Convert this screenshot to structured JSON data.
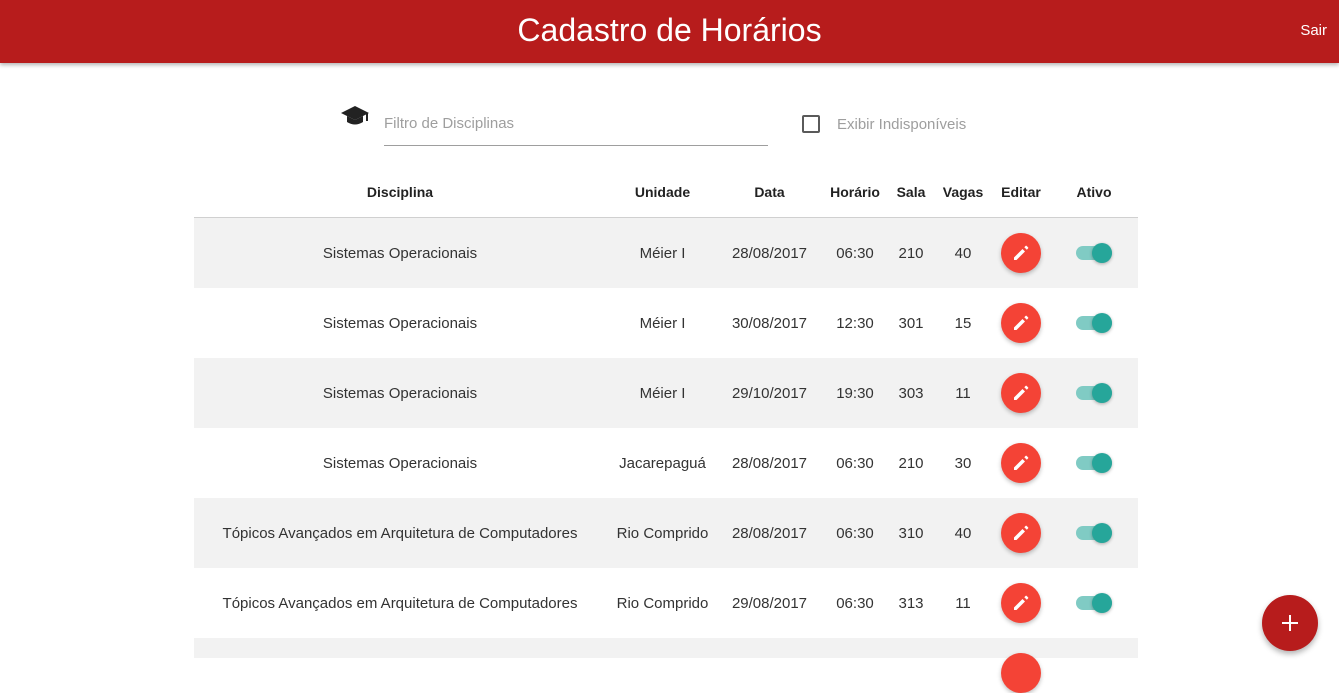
{
  "header": {
    "title": "Cadastro de Horários",
    "logout_label": "Sair"
  },
  "filter": {
    "icon": "graduation-cap-icon",
    "placeholder": "Filtro de Disciplinas",
    "value": "",
    "show_unavailable_label": "Exibir Indisponíveis",
    "show_unavailable_checked": false
  },
  "table": {
    "headers": {
      "discipline": "Disciplina",
      "unit": "Unidade",
      "date": "Data",
      "time": "Horário",
      "room": "Sala",
      "vacancies": "Vagas",
      "edit": "Editar",
      "active": "Ativo"
    },
    "rows": [
      {
        "discipline": "Sistemas Operacionais",
        "unit": "Méier I",
        "date": "28/08/2017",
        "time": "06:30",
        "room": "210",
        "vacancies": "40",
        "active": true
      },
      {
        "discipline": "Sistemas Operacionais",
        "unit": "Méier I",
        "date": "30/08/2017",
        "time": "12:30",
        "room": "301",
        "vacancies": "15",
        "active": true
      },
      {
        "discipline": "Sistemas Operacionais",
        "unit": "Méier I",
        "date": "29/10/2017",
        "time": "19:30",
        "room": "303",
        "vacancies": "11",
        "active": true
      },
      {
        "discipline": "Sistemas Operacionais",
        "unit": "Jacarepaguá",
        "date": "28/08/2017",
        "time": "06:30",
        "room": "210",
        "vacancies": "30",
        "active": true
      },
      {
        "discipline": "Tópicos Avançados em Arquitetura de Computadores",
        "unit": "Rio Comprido",
        "date": "28/08/2017",
        "time": "06:30",
        "room": "310",
        "vacancies": "40",
        "active": true
      },
      {
        "discipline": "Tópicos Avançados em Arquitetura de Computadores",
        "unit": "Rio Comprido",
        "date": "29/08/2017",
        "time": "06:30",
        "room": "313",
        "vacancies": "11",
        "active": true
      }
    ]
  },
  "fab": {
    "icon": "plus-icon"
  },
  "colors": {
    "primary": "#b71c1c",
    "edit_button": "#f44336",
    "toggle_on": "#26a69a",
    "toggle_track": "#80cbc4",
    "row_stripe": "#f2f2f2"
  }
}
